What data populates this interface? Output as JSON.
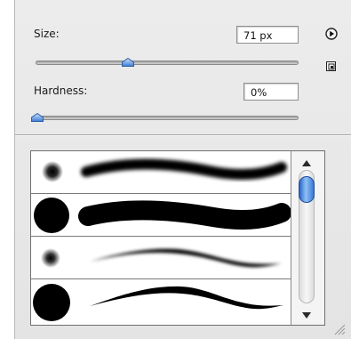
{
  "size": {
    "label": "Size:",
    "value": "71 px",
    "slider_fraction": 0.38
  },
  "hardness": {
    "label": "Hardness:",
    "value": "0%",
    "slider_fraction": 0.0
  },
  "icons": {
    "menu": "play-circle-icon",
    "new_preset": "new-preset-icon",
    "resize": "resize-grip-icon"
  },
  "brush_presets": [
    {
      "tip": "soft",
      "stroke": "soft-thick"
    },
    {
      "tip": "hard",
      "stroke": "hard-thick"
    },
    {
      "tip": "soft",
      "stroke": "soft-taper"
    },
    {
      "tip": "hard",
      "stroke": "hard-taper"
    }
  ],
  "colors": {
    "thumb": "#4a86d6",
    "scroll_thumb": "#3a78d6"
  }
}
